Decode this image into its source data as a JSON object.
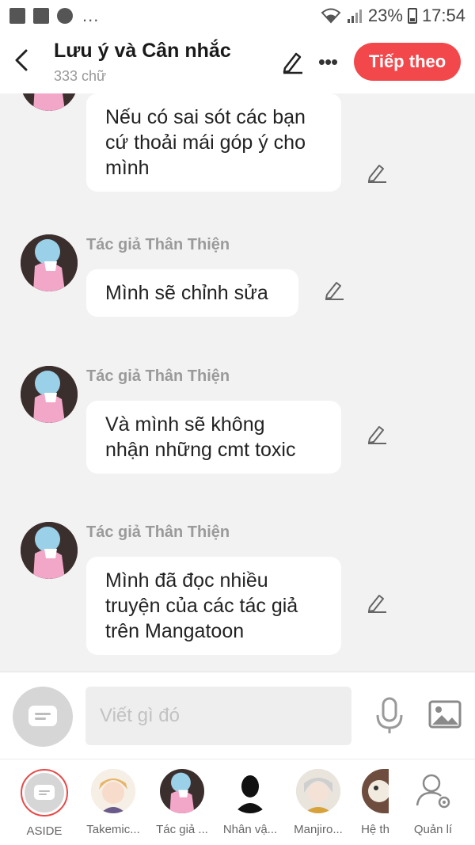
{
  "status_bar": {
    "left_icons": [
      "image-icon",
      "flipboard-icon",
      "messenger-icon"
    ],
    "more": "...",
    "battery": "23%",
    "time": "17:54"
  },
  "header": {
    "title": "Lưu ý và Cân nhắc",
    "subtitle": "333 chữ",
    "next_label": "Tiếp theo",
    "accent": "#f2484c"
  },
  "messages": [
    {
      "author": "",
      "text": "Nếu có sai sót các bạn cứ thoải mái góp ý cho mình",
      "lines": [
        "Nếu có sai sót các bạn",
        "cứ thoải mái góp ý cho",
        "mình"
      ]
    },
    {
      "author": "Tác giả Thân Thiện",
      "text": "Mình sẽ chỉnh sửa",
      "lines": [
        "Mình sẽ chỉnh sửa"
      ]
    },
    {
      "author": "Tác giả Thân Thiện",
      "text": "Và mình sẽ không nhận những cmt toxic",
      "lines": [
        "Và mình sẽ không",
        "nhận những cmt toxic"
      ]
    },
    {
      "author": "Tác giả Thân Thiện",
      "text": "Mình đã đọc nhiều truyện của các tác giả trên Mangatoon",
      "lines": [
        "Mình đã đọc nhiều",
        "truyện của các tác giả",
        "trên Mangatoon"
      ]
    }
  ],
  "composer": {
    "placeholder": "Viết gì đó"
  },
  "characters": [
    {
      "name": "ASIDE",
      "selected": true
    },
    {
      "name": "Takemic..."
    },
    {
      "name": "Tác giả ..."
    },
    {
      "name": "Nhân vậ..."
    },
    {
      "name": "Manjiro..."
    },
    {
      "name": "Hệ th"
    },
    {
      "name": "Quản lí"
    }
  ]
}
